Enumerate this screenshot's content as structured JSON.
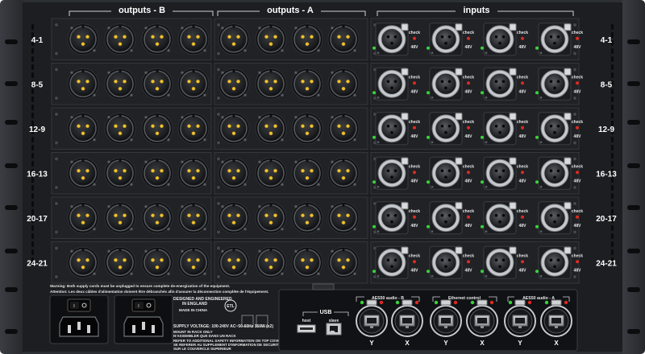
{
  "sections": {
    "outputs_b": "outputs - B",
    "outputs_a": "outputs - A",
    "inputs": "inputs"
  },
  "row_labels": [
    "4-1",
    "8-5",
    "12-9",
    "16-13",
    "20-17",
    "24-21"
  ],
  "input_labels": {
    "check": "check",
    "phantom": "48V"
  },
  "warning": {
    "line1": "Warning: Both supply cords must be unplugged to ensure complete de-energization of the equipment.",
    "line2": "Attention: Les deux câbles d'alimentation doivent être débranchés afin d'assurer la déconnection complète de l'équipement."
  },
  "info": {
    "designed": "DESIGNED AND ENGINEERED",
    "england": "IN ENGLAND",
    "made": "MADE IN CHINA",
    "supply": "SUPPLY VOLTAGE: 100-240V  AC~50-60Hz 150W (x2)",
    "mount1": "MOUNT IN RACK ONLY",
    "mount2": "N'ASSEMBLER QUE DANS UN RACK",
    "refer1": "REFER TO ADDITIONAL SAFETY INFORMATION ON TOP COVER",
    "refer2": "SE REFERER AU SUPPLEMENT D'INFORMATION DE SECURITE",
    "refer3": "SUR LE COUVERCLE SUPERIEUR"
  },
  "io_panel": {
    "usb": "USB",
    "host": "host",
    "slave": "slave",
    "aes_b": "AES50 audio - B",
    "ethernet": "Ethernet control",
    "aes_a": "AES50 audio - A",
    "port_labels": [
      "Y",
      "X",
      "Y",
      "X",
      "Y",
      "X"
    ]
  },
  "colors": {
    "chassis": "#2e3135",
    "panel": "#141619",
    "led_green": "#39d33a",
    "led_red": "#e02a1f"
  }
}
